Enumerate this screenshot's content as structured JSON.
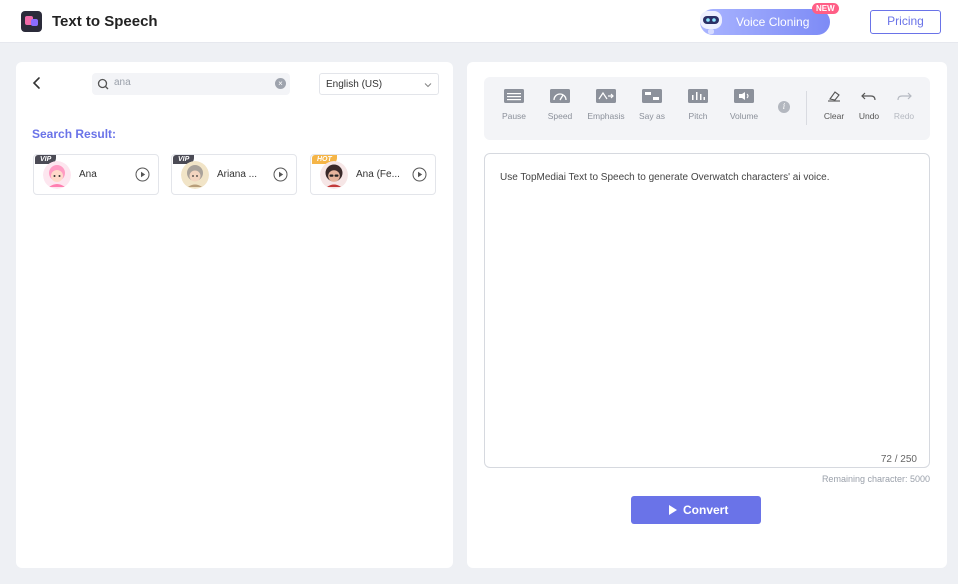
{
  "header": {
    "app_title": "Text to Speech",
    "voice_cloning_label": "Voice Cloning",
    "new_badge": "NEW",
    "pricing_label": "Pricing"
  },
  "left_panel": {
    "search": {
      "value": "ana",
      "placeholder": "ana"
    },
    "language": "English (US)",
    "result_title": "Search Result:",
    "voices": [
      {
        "name": "Ana",
        "badge": "VIP",
        "badge_type": "vip",
        "avatar_icon": "pink-character-avatar"
      },
      {
        "name": "Ariana ...",
        "badge": "VIP",
        "badge_type": "vip",
        "avatar_icon": "grey-hair-woman-avatar"
      },
      {
        "name": "Ana (Fe...",
        "badge": "HOT",
        "badge_type": "hot",
        "avatar_icon": "woman-sunglasses-avatar"
      }
    ]
  },
  "toolbar": {
    "tools": [
      {
        "label": "Pause",
        "icon": "pause-lines-icon"
      },
      {
        "label": "Speed",
        "icon": "speedometer-icon"
      },
      {
        "label": "Emphasis",
        "icon": "emphasis-icon"
      },
      {
        "label": "Say as",
        "icon": "say-as-icon"
      },
      {
        "label": "Pitch",
        "icon": "pitch-bars-icon"
      },
      {
        "label": "Volume",
        "icon": "volume-icon"
      }
    ],
    "info_symbol": "i",
    "clear_label": "Clear",
    "undo_label": "Undo",
    "redo_label": "Redo"
  },
  "editor": {
    "text": "Use TopMediai Text to Speech to generate Overwatch characters' ai voice.",
    "char_count": "72 / 250",
    "remaining": "Remaining character: 5000"
  },
  "convert_label": "Convert",
  "colors": {
    "accent": "#6a73e8",
    "hot": "#f5b547",
    "vip": "#4b4b55",
    "new": "#ff5e86"
  }
}
